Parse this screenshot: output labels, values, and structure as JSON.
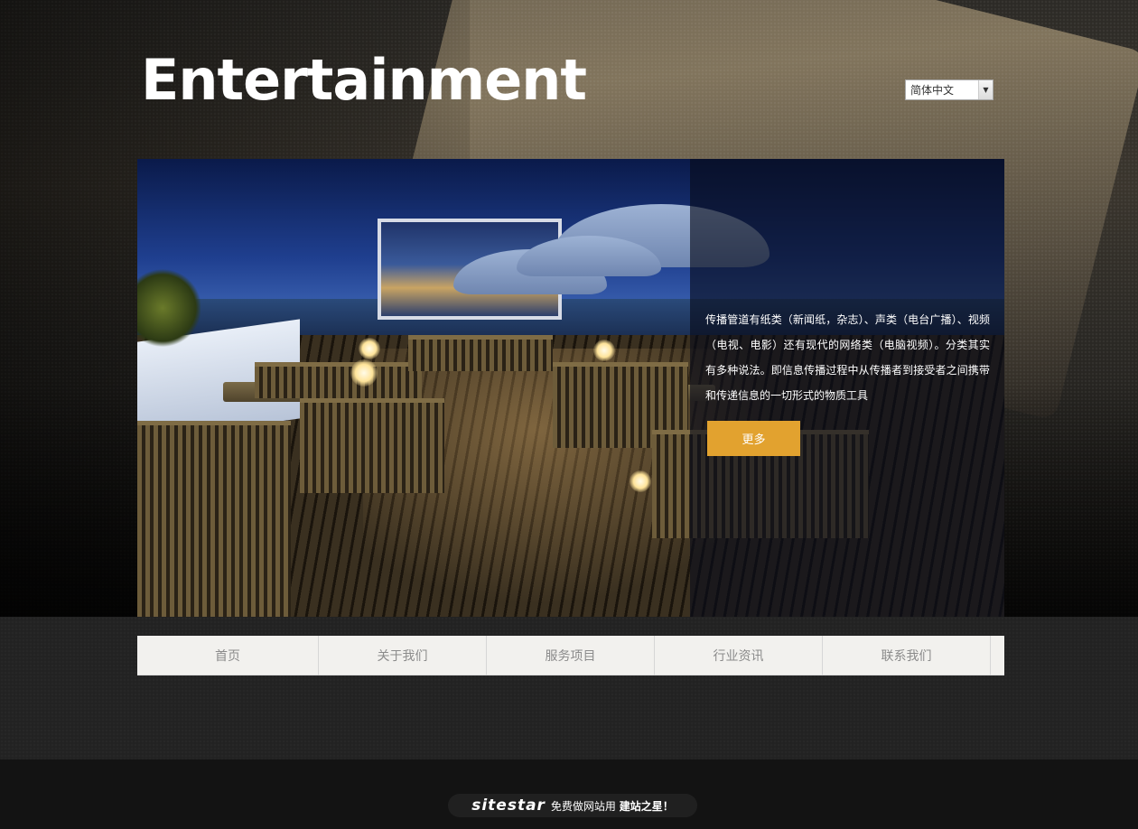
{
  "header": {
    "title": "Entertainment",
    "language_select": {
      "value": "简体中文"
    }
  },
  "banner": {
    "description": "传播管道有纸类（新闻纸，杂志）、声类（电台广播）、视频（电视、电影）还有现代的网络类（电脑视频）。分类其实有多种说法。即信息传播过程中从传播者到接受者之间携带和传递信息的一切形式的物质工具",
    "more_label": "更多"
  },
  "nav": {
    "items": [
      {
        "label": "首页"
      },
      {
        "label": "关于我们"
      },
      {
        "label": "服务项目"
      },
      {
        "label": "行业资讯"
      },
      {
        "label": "联系我们"
      }
    ]
  },
  "footer": {
    "logo": "sitestar",
    "text_prefix": "免费做网站用",
    "text_brand": "建站之星！"
  },
  "colors": {
    "accent": "#e2a22f",
    "nav_bg": "#f2f1ee",
    "nav_text": "#8b8b8b"
  }
}
